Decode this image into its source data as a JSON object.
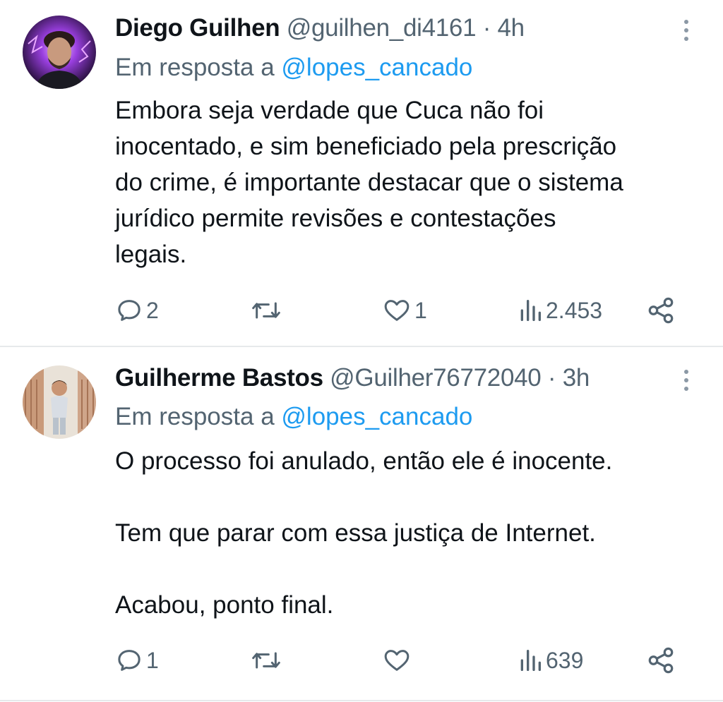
{
  "tweets": [
    {
      "author_name": "Diego Guilhen",
      "handle": "@guilhen_di4161",
      "separator": "·",
      "time": "4h",
      "reply_prefix": "Em resposta a",
      "reply_to": "@lopes_cancado",
      "body_lines": [
        "Embora seja verdade que Cuca não foi",
        "inocentado, e sim beneficiado pela prescrição",
        "do crime, é importante destacar que o sistema",
        "jurídico permite revisões e contestações",
        "legais."
      ],
      "reply_count": "2",
      "retweet_count": "",
      "like_count": "1",
      "view_count": "2.453"
    },
    {
      "author_name": "Guilherme Bastos",
      "handle": "@Guilher76772040",
      "separator": "·",
      "time": "3h",
      "reply_prefix": "Em resposta a",
      "reply_to": "@lopes_cancado",
      "body_lines": [
        "O processo foi anulado, então ele é inocente.",
        "",
        "Tem que parar com essa justiça de Internet.",
        "",
        "Acabou, ponto final."
      ],
      "reply_count": "1",
      "retweet_count": "",
      "like_count": "",
      "view_count": "639"
    }
  ],
  "icons": {
    "reply": "reply-icon",
    "retweet": "retweet-icon",
    "like": "heart-icon",
    "views": "views-icon",
    "share": "share-icon",
    "more": "more-icon"
  },
  "colors": {
    "text": "#0f1419",
    "secondary": "#536471",
    "mention": "#1d9bf0",
    "divider": "#e6e9eb"
  }
}
